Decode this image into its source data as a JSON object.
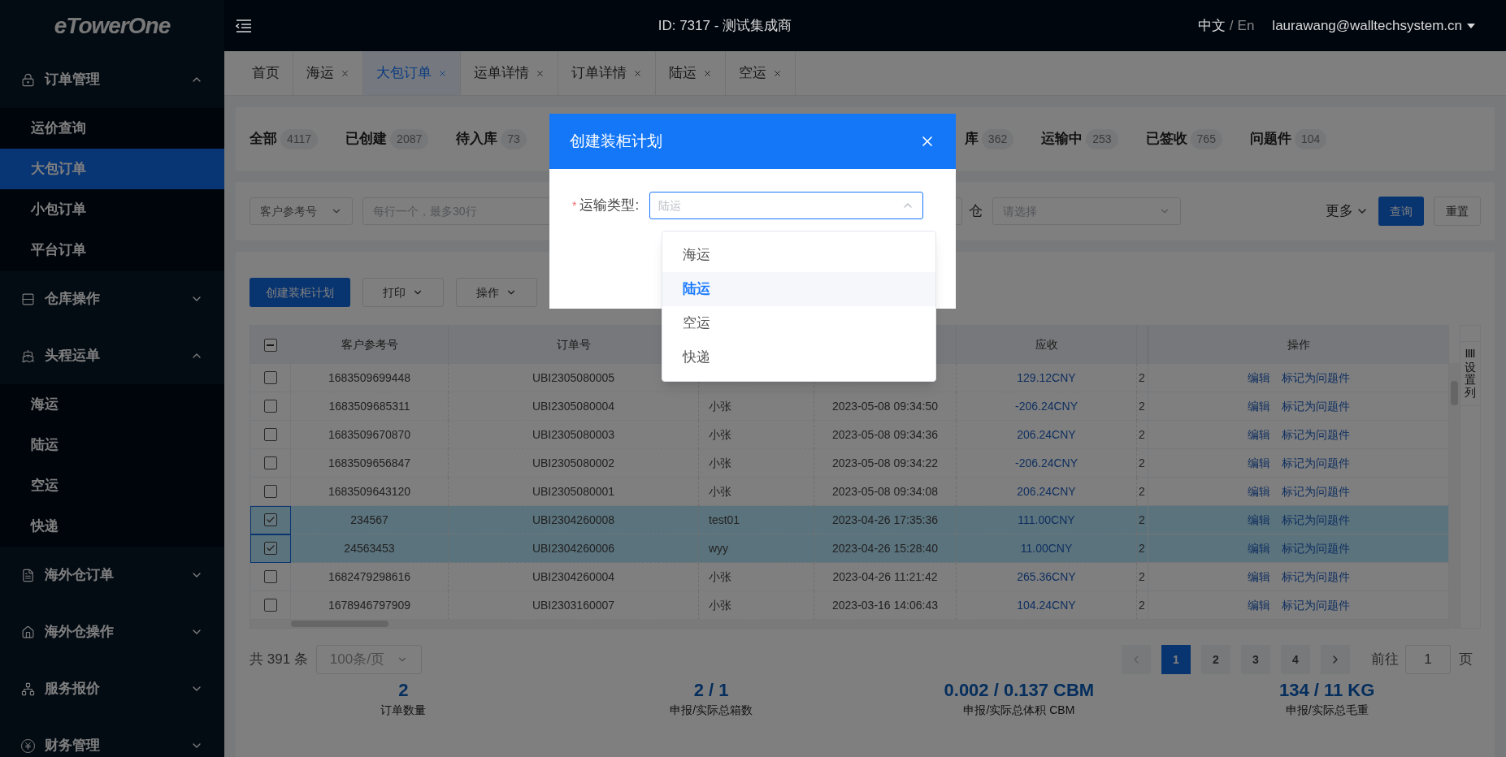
{
  "header": {
    "logo": "eTowerOne",
    "title": "ID: 7317 - 测试集成商",
    "lang_zh": "中文",
    "lang_sep": "/",
    "lang_en": "En",
    "user": "laurawang@walltechsystem.cn"
  },
  "sidebar": {
    "groups": [
      {
        "label": "订单管理",
        "kind": "lock",
        "expanded": true,
        "children": [
          {
            "label": "运价查询",
            "selected": false
          },
          {
            "label": "大包订单",
            "selected": true
          },
          {
            "label": "小包订单",
            "selected": false
          },
          {
            "label": "平台订单",
            "selected": false
          }
        ]
      },
      {
        "label": "仓库操作",
        "kind": "rows",
        "expanded": false
      },
      {
        "label": "头程运单",
        "kind": "ship",
        "expanded": true,
        "children": [
          {
            "label": "海运",
            "selected": false
          },
          {
            "label": "陆运",
            "selected": false
          },
          {
            "label": "空运",
            "selected": false
          },
          {
            "label": "快递",
            "selected": false
          }
        ]
      },
      {
        "label": "海外仓订单",
        "kind": "document",
        "expanded": false
      },
      {
        "label": "海外仓操作",
        "kind": "house",
        "expanded": false
      },
      {
        "label": "服务报价",
        "kind": "network",
        "expanded": false
      },
      {
        "label": "财务管理",
        "kind": "yen",
        "expanded": false
      }
    ]
  },
  "tabs": [
    {
      "label": "首页",
      "closable": false,
      "selected": false
    },
    {
      "label": "海运",
      "closable": true,
      "selected": false
    },
    {
      "label": "大包订单",
      "closable": true,
      "selected": true
    },
    {
      "label": "运单详情",
      "closable": true,
      "selected": false
    },
    {
      "label": "订单详情",
      "closable": true,
      "selected": false
    },
    {
      "label": "陆运",
      "closable": true,
      "selected": false
    },
    {
      "label": "空运",
      "closable": true,
      "selected": false
    }
  ],
  "status_filters": [
    {
      "label": "全部",
      "count": "4117"
    },
    {
      "label": "已创建",
      "count": "2087"
    },
    {
      "label": "待入库",
      "count": "73"
    },
    {
      "label": "库",
      "count": "362"
    },
    {
      "label": "运输中",
      "count": "253"
    },
    {
      "label": "已签收",
      "count": "765"
    },
    {
      "label": "问题件",
      "count": "104"
    }
  ],
  "search": {
    "field_select": "客户参考号",
    "input_placeholder": "每行一个，最多30行",
    "second_label": "仓",
    "second_placeholder": "请选择",
    "more": "更多",
    "query": "查询",
    "reset": "重置"
  },
  "toolbar": [
    {
      "label": "创建装柜计划",
      "kind": "primary"
    },
    {
      "label": "打印",
      "kind": "dropdown"
    },
    {
      "label": "操作",
      "kind": "dropdown"
    }
  ],
  "table": {
    "header_checkbox": {
      "indeterminate": true
    },
    "columns": {
      "ref": "客户参考号",
      "order": "订单号",
      "amount": "应收",
      "actions": "操作"
    },
    "settings": "设置列",
    "rows": [
      {
        "checked": false,
        "ref": "1683509699448",
        "order": "UBI2305080005",
        "amount": "129.12CNY",
        "column_6": "2",
        "actions": [
          "编辑",
          "标记为问题件"
        ]
      },
      {
        "checked": false,
        "ref": "1683509685311",
        "order": "UBI2305080004",
        "column_3": "小张",
        "column_4": "2023-05-08 09:34:50",
        "amount": "-206.24CNY",
        "column_6": "2",
        "actions": [
          "编辑",
          "标记为问题件"
        ]
      },
      {
        "checked": false,
        "ref": "1683509670870",
        "order": "UBI2305080003",
        "column_3": "小张",
        "column_4": "2023-05-08 09:34:36",
        "amount": "206.24CNY",
        "column_6": "2",
        "actions": [
          "编辑",
          "标记为问题件"
        ]
      },
      {
        "checked": false,
        "ref": "1683509656847",
        "order": "UBI2305080002",
        "column_3": "小张",
        "column_4": "2023-05-08 09:34:22",
        "amount": "-206.24CNY",
        "column_6": "2",
        "actions": [
          "编辑",
          "标记为问题件"
        ]
      },
      {
        "checked": false,
        "ref": "1683509643120",
        "order": "UBI2305080001",
        "column_3": "小张",
        "column_4": "2023-05-08 09:34:08",
        "amount": "206.24CNY",
        "column_6": "2",
        "actions": [
          "编辑",
          "标记为问题件"
        ]
      },
      {
        "checked": true,
        "ref": "234567",
        "order": "UBI2304260008",
        "column_3": "test01",
        "column_4": "2023-04-26 17:35:36",
        "amount": "111.00CNY",
        "column_6": "2",
        "actions": [
          "编辑",
          "标记为问题件"
        ]
      },
      {
        "checked": true,
        "ref": "24563453",
        "order": "UBI2304260006",
        "column_3": "wyy",
        "column_4": "2023-04-26 15:28:40",
        "amount": "11.00CNY",
        "column_6": "2",
        "actions": [
          "编辑",
          "标记为问题件"
        ]
      },
      {
        "checked": false,
        "ref": "1682479298616",
        "order": "UBI2304260004",
        "column_3": "小张",
        "column_4": "2023-04-26 11:21:42",
        "amount": "265.36CNY",
        "column_6": "2",
        "actions": [
          "编辑",
          "标记为问题件"
        ]
      },
      {
        "checked": false,
        "ref": "1678946797909",
        "order": "UBI2303160007",
        "column_3": "小张",
        "column_4": "2023-03-16 14:06:43",
        "amount": "104.24CNY",
        "column_6": "2",
        "actions": [
          "编辑",
          "标记为问题件"
        ]
      }
    ]
  },
  "pagination": {
    "total": "共 391 条",
    "page_size": "100条/页",
    "pages": [
      {
        "label": "1",
        "selected": true
      },
      {
        "label": "2",
        "selected": false
      },
      {
        "label": "3",
        "selected": false
      },
      {
        "label": "4",
        "selected": false
      }
    ],
    "goto_label": "前往",
    "goto_value": "1",
    "goto_suffix": "页"
  },
  "summary": [
    {
      "value": "2",
      "label": "订单数量"
    },
    {
      "value": "2 / 1",
      "label": "申报/实际总箱数"
    },
    {
      "value": "0.002 / 0.137 CBM",
      "label": "申报/实际总体积 CBM"
    },
    {
      "value": "134 / 11 KG",
      "label": "申报/实际总毛重"
    }
  ],
  "modal": {
    "title": "创建装柜计划",
    "field_label": "运输类型:",
    "required_mark": "*",
    "placeholder": "陆运",
    "options": [
      {
        "label": "海运",
        "selected": false
      },
      {
        "label": "陆运",
        "selected": true
      },
      {
        "label": "空运",
        "selected": false
      },
      {
        "label": "快递",
        "selected": false
      }
    ]
  }
}
